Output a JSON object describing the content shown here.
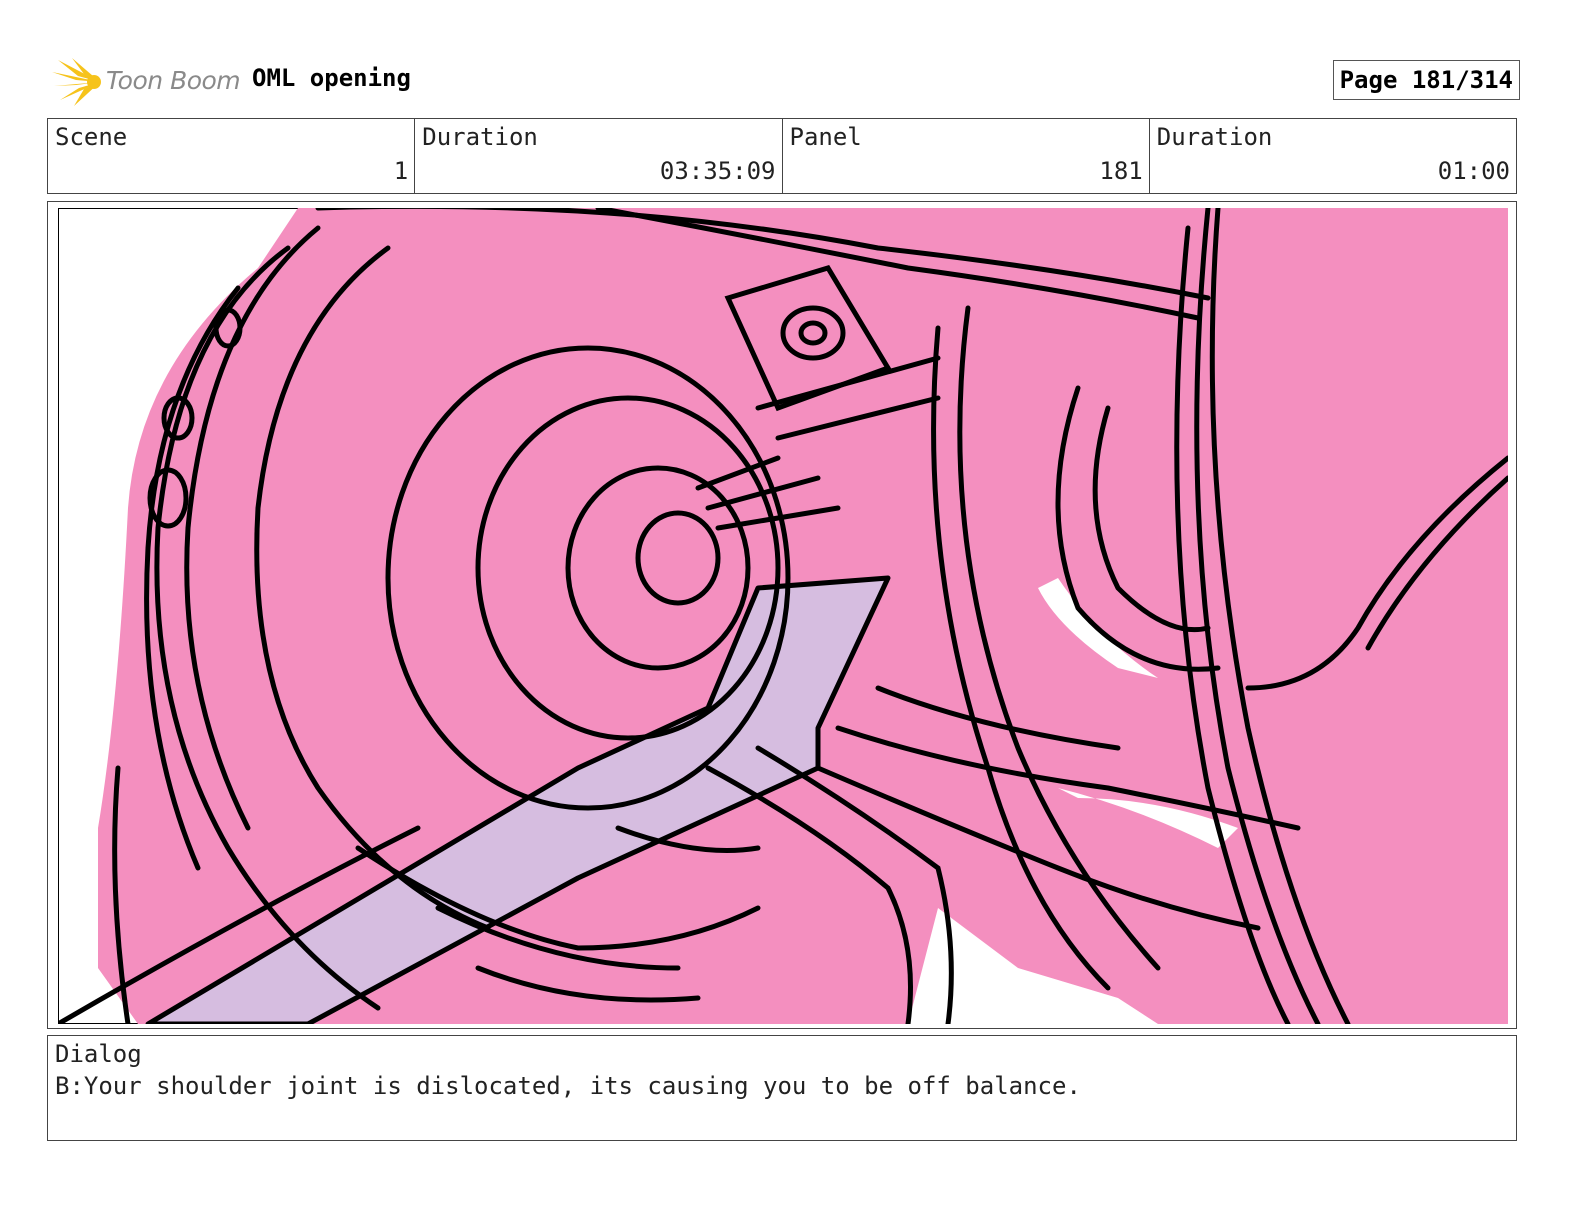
{
  "header": {
    "logo_text": "Toon Boom",
    "project_title": "OML opening",
    "page_label": "Page 181/314"
  },
  "info": {
    "scene_label": "Scene",
    "scene_value": "1",
    "duration_label": "Duration",
    "duration_value": "03:35:09",
    "panel_label": "Panel",
    "panel_value": "181",
    "panel_duration_label": "Duration",
    "panel_duration_value": "01:00"
  },
  "panel_image": {
    "icon": "storyboard-sketch",
    "colors": {
      "background": "#f48fbf",
      "arm": "#d6bde0",
      "ink": "#000000",
      "highlight": "#ffffff"
    }
  },
  "dialog": {
    "label": "Dialog",
    "text": "B:Your shoulder joint is dislocated, its causing you to be off balance."
  },
  "brand": {
    "logo_color": "#f6c31b",
    "logo_text_color": "#8a8a8a"
  }
}
